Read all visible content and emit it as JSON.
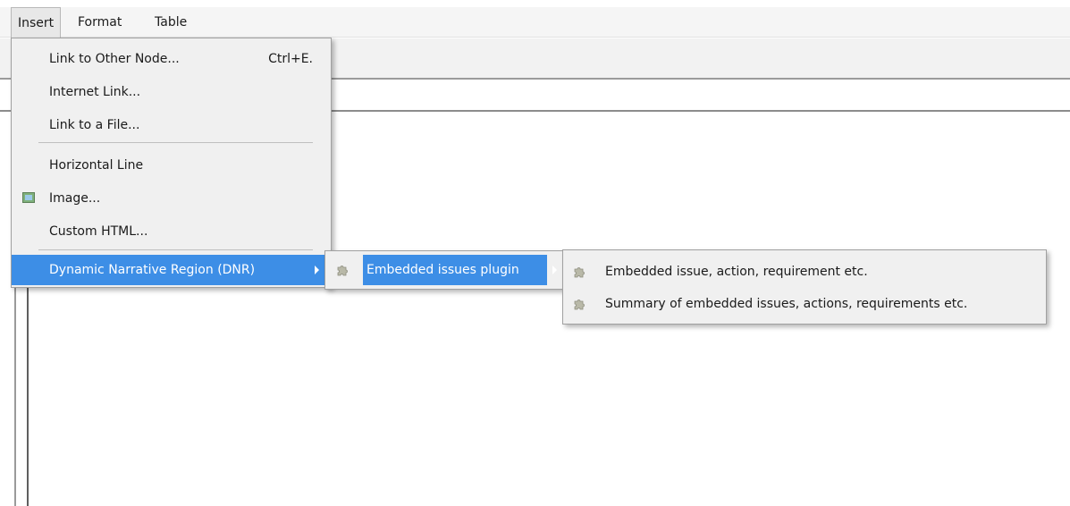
{
  "menubar": {
    "items": [
      {
        "label": "Insert"
      },
      {
        "label": "Format"
      },
      {
        "label": "Table"
      }
    ]
  },
  "insert_menu": {
    "items": [
      {
        "label": "Link to Other Node...",
        "shortcut": "Ctrl+E."
      },
      {
        "label": "Internet Link..."
      },
      {
        "label": "Link to a File..."
      },
      {
        "label": "Horizontal Line"
      },
      {
        "label": "Image...",
        "icon": "image-icon"
      },
      {
        "label": "Custom HTML..."
      },
      {
        "label": "Dynamic Narrative Region (DNR)",
        "has_submenu": true
      }
    ]
  },
  "dnr_submenu": {
    "items": [
      {
        "label": "Embedded issues plugin",
        "icon": "puzzle-icon",
        "has_submenu": true
      }
    ]
  },
  "plugin_submenu": {
    "items": [
      {
        "label": "Embedded issue, action, requirement etc.",
        "icon": "puzzle-icon"
      },
      {
        "label": "Summary of embedded issues, actions, requirements etc.",
        "icon": "puzzle-icon"
      }
    ]
  },
  "colors": {
    "highlight": "#3d8ee6",
    "menu_bg": "#f0f0f0",
    "menubar_bg": "#f5f5f5"
  }
}
